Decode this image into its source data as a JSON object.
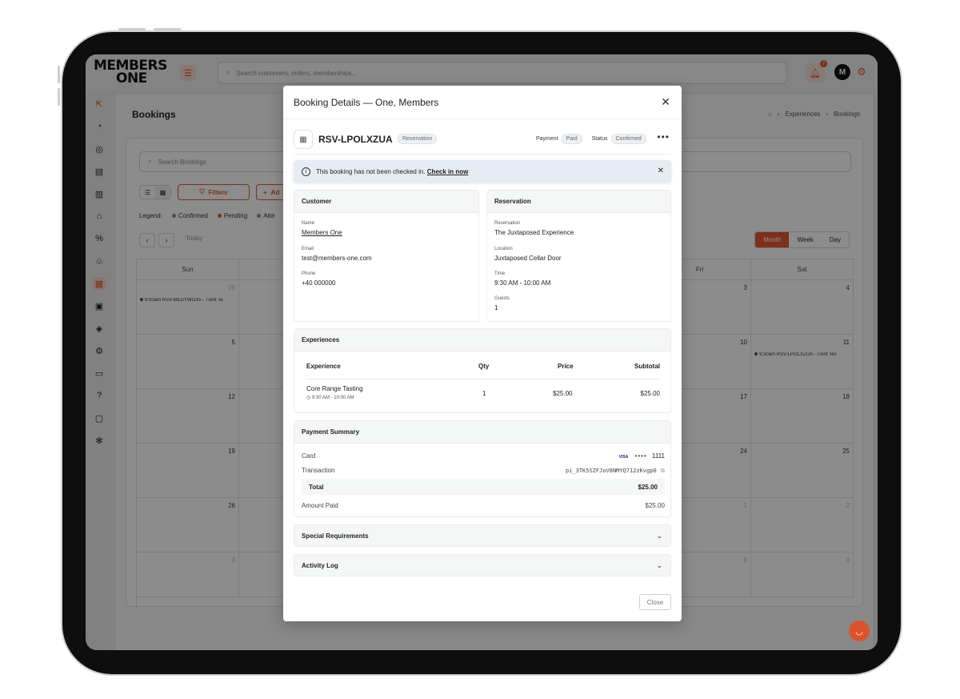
{
  "app": {
    "logo_line1": "MEMBERS",
    "logo_line2": "ONE",
    "search_placeholder": "Search customers, orders, memberships...",
    "notification_count": "7",
    "avatar_initial": "M",
    "accent_color": "#e4572e"
  },
  "sidebar": {
    "icons": [
      "external-link-icon",
      "bell-icon",
      "dashboard-icon",
      "orders-icon",
      "invoice-icon",
      "store-icon",
      "percent-icon",
      "club-icon",
      "calendar-icon",
      "clipboard-icon",
      "box-icon",
      "settings-icon",
      "monitor-icon",
      "help-icon",
      "feedback-icon",
      "integrations-icon"
    ]
  },
  "page": {
    "title": "Bookings",
    "breadcrumb": [
      "Experiences",
      "Bookings"
    ],
    "search_placeholder": "Search Bookings",
    "filters_label": "Filters",
    "add_label": "Ad",
    "legend_label": "Legend:",
    "legend": [
      {
        "label": "Confirmed",
        "color": "#8a8a8a"
      },
      {
        "label": "Pending",
        "color": "#e4572e"
      },
      {
        "label": "Atte",
        "color": "#8a8a8a"
      }
    ],
    "today_label": "Today",
    "range_tabs": [
      "Month",
      "Week",
      "Day"
    ],
    "active_range": "Month"
  },
  "calendar": {
    "days": [
      "Sun",
      "",
      "",
      "",
      "",
      "Fri",
      "Sat"
    ],
    "dates": [
      [
        "29",
        "",
        "",
        "",
        "",
        "3",
        "4"
      ],
      [
        "5",
        "",
        "",
        "",
        "",
        "10",
        "11"
      ],
      [
        "12",
        "",
        "",
        "",
        "",
        "17",
        "18"
      ],
      [
        "19",
        "",
        "",
        "",
        "",
        "24",
        "25"
      ],
      [
        "26",
        "",
        "",
        "",
        "",
        "1",
        "2"
      ],
      [
        "3",
        "",
        "",
        "",
        "",
        "8",
        "9"
      ]
    ],
    "dim_rows": {
      "0": [
        0
      ],
      "4": [
        5,
        6
      ],
      "5": [
        0,
        5,
        6
      ]
    },
    "events": [
      {
        "text": "9:00am RSV-MEDYWOX5 - Trent Te",
        "row": 0,
        "col": 0
      },
      {
        "text": "9:30am RSV-LPOLXZUA - Trent Tes",
        "row": 1,
        "col": 6
      }
    ]
  },
  "modal": {
    "title": "Booking Details — One, Members",
    "booking_id": "RSV-LPOLXZUA",
    "booking_type": "Reservation",
    "payment_label": "Payment",
    "payment_status": "Paid",
    "status_label": "Status",
    "status_value": "Confirmed",
    "alert_text": "This booking has not been checked in.",
    "alert_link": "Check in now",
    "customer": {
      "heading": "Customer",
      "name_label": "Name",
      "name": "Members One",
      "email_label": "Email",
      "email": "test@members-one.com",
      "phone_label": "Phone",
      "phone": "+40 000000"
    },
    "reservation": {
      "heading": "Reservation",
      "reservation_label": "Reservation",
      "reservation": "The Juxtaposed Experience",
      "location_label": "Location",
      "location": "Juxtaposed Cellar Door",
      "time_label": "Time",
      "time": "9:30 AM - 10:00 AM",
      "guests_label": "Guests",
      "guests": "1"
    },
    "experiences": {
      "heading": "Experiences",
      "columns": [
        "Experience",
        "Qty",
        "Price",
        "Subtotal"
      ],
      "rows": [
        {
          "name": "Core Range Tasting",
          "time": "9:30 AM - 10:00 AM",
          "qty": "1",
          "price": "$25.00",
          "subtotal": "$25.00"
        }
      ]
    },
    "payment": {
      "heading": "Payment Summary",
      "card_label": "Card",
      "card_brand": "VISA",
      "card_mask": "••••",
      "card_last4": "1111",
      "transaction_label": "Transaction",
      "transaction_id": "pi_3TK5SZFJoV8NMYQ712zKvgp0",
      "total_label": "Total",
      "total": "$25.00",
      "amount_paid_label": "Amount Paid",
      "amount_paid": "$25.00"
    },
    "special_requirements": "Special Requirements",
    "activity_log": "Activity Log",
    "close_label": "Close"
  }
}
